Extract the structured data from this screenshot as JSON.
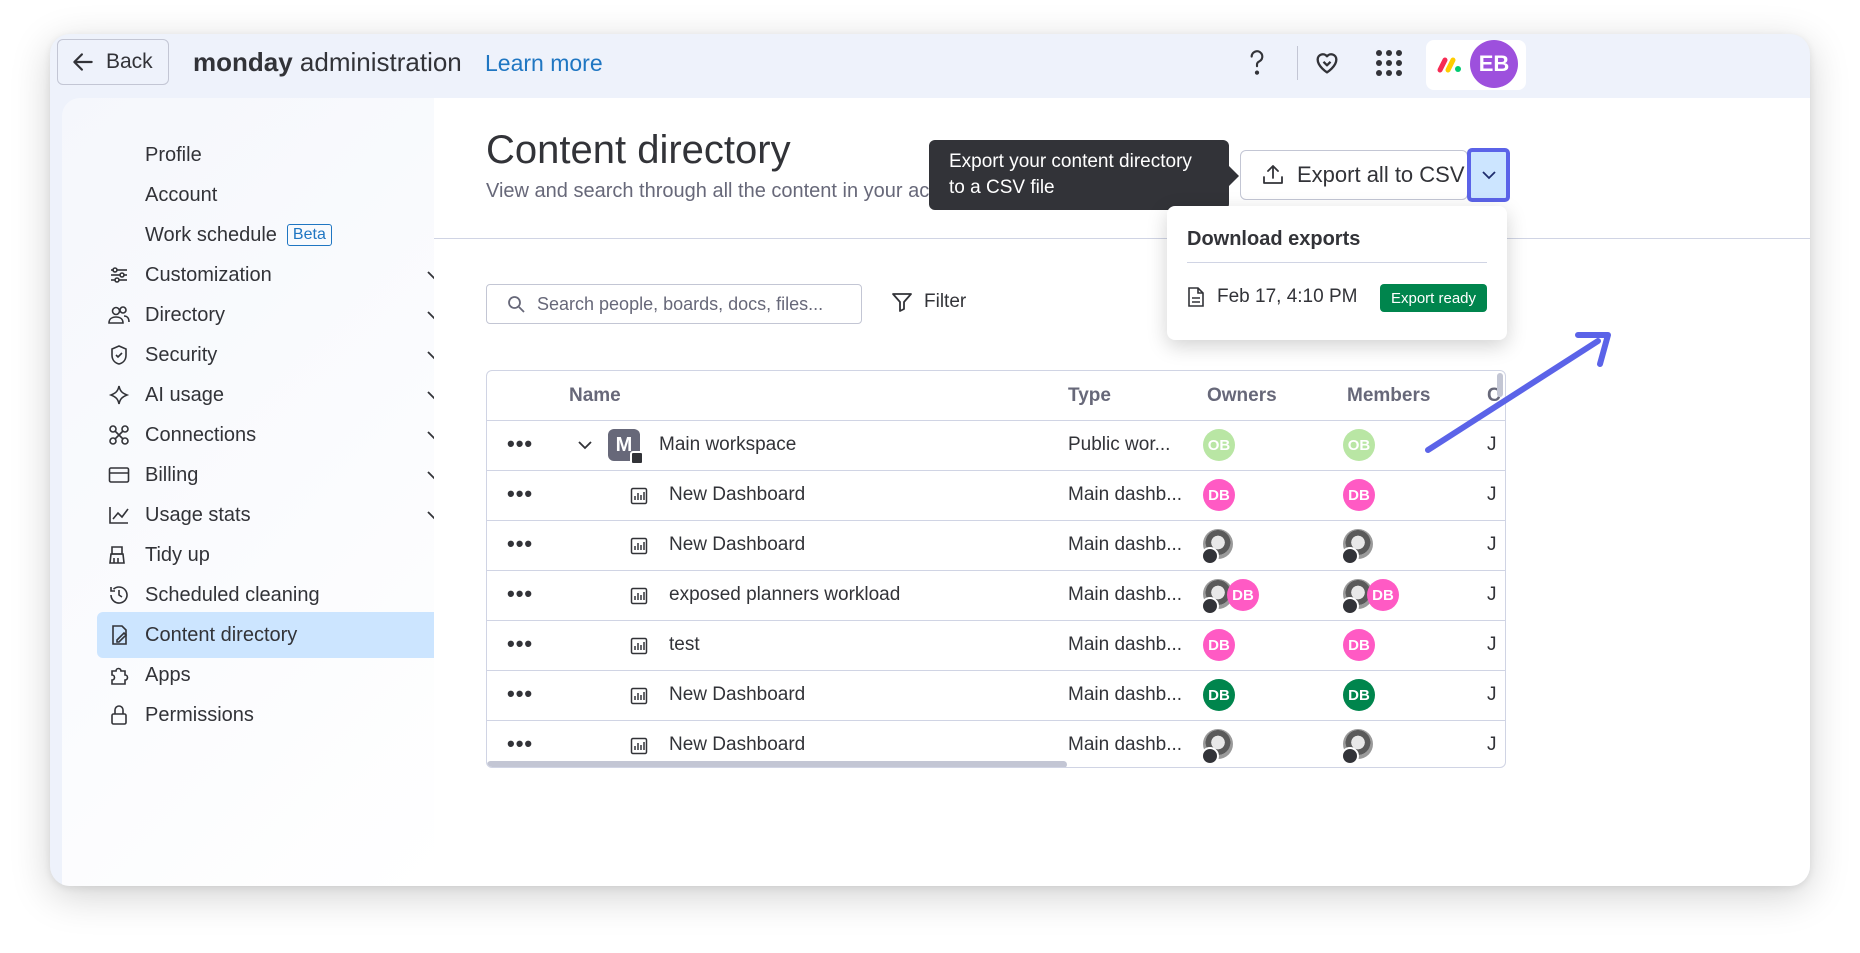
{
  "topbar": {
    "back_label": "Back",
    "brand_bold": "monday",
    "brand_rest": " administration",
    "learn_more": "Learn more",
    "avatar_initials": "EB"
  },
  "sidebar": {
    "items": [
      {
        "label": "Profile",
        "icon": "",
        "expandable": false
      },
      {
        "label": "Account",
        "icon": "",
        "expandable": false
      },
      {
        "label": "Work schedule",
        "icon": "",
        "expandable": false,
        "badge": "Beta"
      },
      {
        "label": "Customization",
        "icon": "sliders-icon",
        "expandable": true
      },
      {
        "label": "Directory",
        "icon": "people-icon",
        "expandable": true
      },
      {
        "label": "Security",
        "icon": "shield-icon",
        "expandable": true
      },
      {
        "label": "AI usage",
        "icon": "sparkle-icon",
        "expandable": true
      },
      {
        "label": "Connections",
        "icon": "connections-icon",
        "expandable": true
      },
      {
        "label": "Billing",
        "icon": "credit-card-icon",
        "expandable": true
      },
      {
        "label": "Usage stats",
        "icon": "chart-icon",
        "expandable": true
      },
      {
        "label": "Tidy up",
        "icon": "broom-icon",
        "expandable": false
      },
      {
        "label": "Scheduled cleaning",
        "icon": "history-icon",
        "expandable": false
      },
      {
        "label": "Content directory",
        "icon": "content-icon",
        "expandable": false,
        "active": true
      },
      {
        "label": "Apps",
        "icon": "puzzle-icon",
        "expandable": false
      },
      {
        "label": "Permissions",
        "icon": "lock-icon",
        "expandable": false
      }
    ]
  },
  "main": {
    "title": "Content directory",
    "subtitle": "View and search through all the content in your account.",
    "tooltip": "Export your content directory to a CSV file",
    "export_label": "Export all to CSV",
    "search_placeholder": "Search people, boards, docs, files...",
    "filter_label": "Filter"
  },
  "download_panel": {
    "title": "Download exports",
    "file_label": "Feb 17, 4:10 PM",
    "status": "Export ready"
  },
  "table": {
    "headers": [
      "Name",
      "Type",
      "Owners",
      "Members",
      "C"
    ],
    "rows": [
      {
        "name": "Main workspace",
        "type": "Public wor...",
        "kind": "workspace",
        "owners": [
          {
            "initials": "OB",
            "color": "#b9e6a4"
          }
        ],
        "members": [
          {
            "initials": "OB",
            "color": "#b9e6a4"
          }
        ],
        "last": "J"
      },
      {
        "name": "New Dashboard",
        "type": "Main dashb...",
        "kind": "dashboard",
        "owners": [
          {
            "initials": "DB",
            "color": "#ff5ac4"
          }
        ],
        "members": [
          {
            "initials": "DB",
            "color": "#ff5ac4"
          }
        ],
        "last": "J"
      },
      {
        "name": "New Dashboard",
        "type": "Main dashb...",
        "kind": "dashboard",
        "owners": [
          {
            "initials": "",
            "photo": true
          }
        ],
        "members": [
          {
            "initials": "",
            "photo": true
          }
        ],
        "last": "J"
      },
      {
        "name": "exposed planners workload",
        "type": "Main dashb...",
        "kind": "dashboard",
        "owners": [
          {
            "initials": "",
            "photo": true
          },
          {
            "initials": "DB",
            "color": "#ff5ac4"
          }
        ],
        "members": [
          {
            "initials": "",
            "photo": true
          },
          {
            "initials": "DB",
            "color": "#ff5ac4"
          }
        ],
        "last": "J"
      },
      {
        "name": "test",
        "type": "Main dashb...",
        "kind": "dashboard",
        "owners": [
          {
            "initials": "DB",
            "color": "#ff5ac4"
          }
        ],
        "members": [
          {
            "initials": "DB",
            "color": "#ff5ac4"
          }
        ],
        "last": "J"
      },
      {
        "name": "New Dashboard",
        "type": "Main dashb...",
        "kind": "dashboard",
        "owners": [
          {
            "initials": "DB",
            "color": "#00854d"
          }
        ],
        "members": [
          {
            "initials": "DB",
            "color": "#00854d"
          }
        ],
        "last": "J"
      },
      {
        "name": "New Dashboard",
        "type": "Main dashb...",
        "kind": "dashboard",
        "owners": [
          {
            "initials": "",
            "photo": true
          }
        ],
        "members": [
          {
            "initials": "",
            "photo": true
          }
        ],
        "last": "J"
      }
    ]
  },
  "colors": {
    "accent": "#5b63e8",
    "link": "#1f76c2",
    "active_bg": "#cce5ff",
    "export_ready": "#00854d",
    "avatar_eb": "#9d50dd"
  }
}
